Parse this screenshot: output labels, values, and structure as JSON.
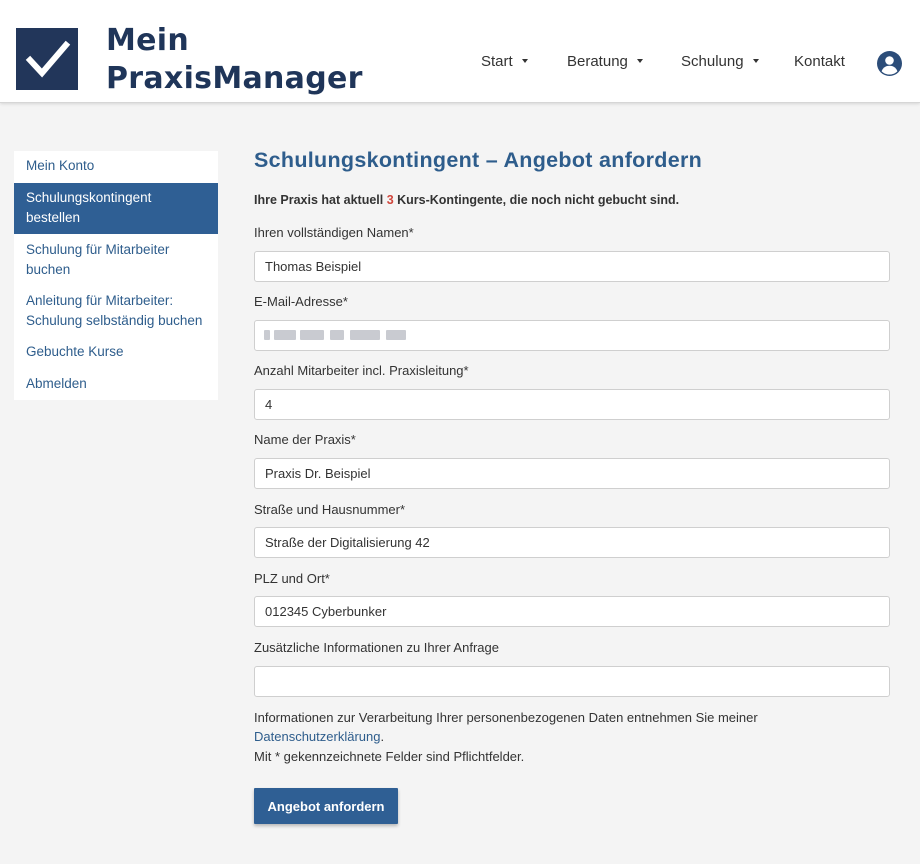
{
  "brand": {
    "line1": "Mein",
    "line2": "PraxisManager"
  },
  "nav": {
    "items": [
      {
        "label": "Start",
        "has_dropdown": true
      },
      {
        "label": "Beratung",
        "has_dropdown": true
      },
      {
        "label": "Schulung",
        "has_dropdown": true
      },
      {
        "label": "Kontakt",
        "has_dropdown": false
      }
    ],
    "user_icon": "user-circle-icon"
  },
  "sidebar": {
    "items": [
      {
        "label": "Mein Konto",
        "active": false
      },
      {
        "label_line1": "Schulungskontingent",
        "label_line2": "bestellen",
        "active": true
      },
      {
        "label_line1": "Schulung für Mitarbeiter",
        "label_line2": "buchen",
        "active": false
      },
      {
        "label_line1": "Anleitung für Mitarbeiter:",
        "label_line2": "Schulung selbständig buchen",
        "active": false
      },
      {
        "label": "Gebuchte Kurse",
        "active": false
      },
      {
        "label": "Abmelden",
        "active": false
      }
    ]
  },
  "page": {
    "title": "Schulungskontingent – Angebot anfordern",
    "intro_before": "Ihre Praxis hat aktuell ",
    "intro_count": "3",
    "intro_after": " Kurs-Kontingente, die noch nicht gebucht sind."
  },
  "form": {
    "name": {
      "label": "Ihren vollständigen Namen*",
      "value": "Thomas Beispiel"
    },
    "email": {
      "label": "E-Mail-Adresse*",
      "value": ""
    },
    "employees": {
      "label": "Anzahl Mitarbeiter incl. Praxisleitung*",
      "value": "4"
    },
    "practice": {
      "label": "Name der Praxis*",
      "value": "Praxis Dr. Beispiel"
    },
    "street": {
      "label": "Straße und Hausnummer*",
      "value": "Straße der Digitalisierung 42"
    },
    "city": {
      "label": "PLZ und Ort*",
      "value": "012345 Cyberbunker"
    },
    "additional": {
      "label": "Zusätzliche Informationen zu Ihrer Anfrage",
      "value": ""
    },
    "privacy_text": "Informationen zur Verarbeitung Ihrer personenbezogenen Daten entnehmen Sie meiner",
    "privacy_link": "Datenschutzerklärung",
    "privacy_period": ".",
    "required_note": "Mit * gekennzeichnete Felder sind Pflichtfelder.",
    "submit_label": "Angebot anfordern"
  },
  "colors": {
    "brand_dark": "#1f3559",
    "accent_blue": "#2f5f94",
    "link_blue": "#2e5d8c",
    "highlight_red": "#d0463c",
    "page_bg": "#f4f4f4"
  }
}
